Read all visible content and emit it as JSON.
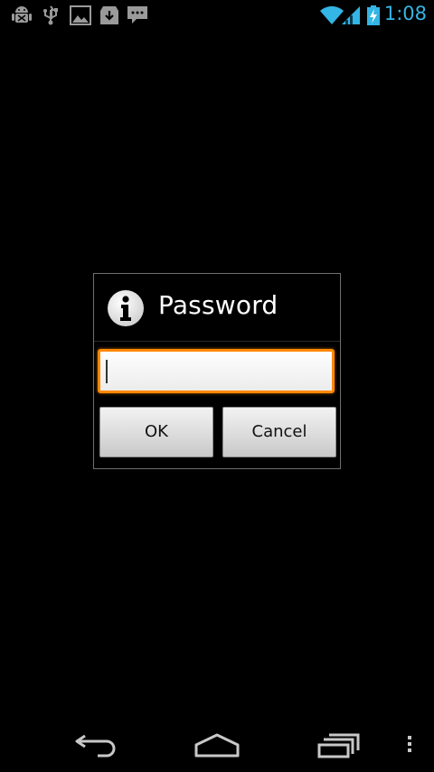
{
  "status_bar": {
    "notification_icons": [
      "android-debug-icon",
      "usb-icon",
      "image-icon",
      "download-icon",
      "message-icon"
    ],
    "time": "1:08",
    "accent_color": "#33b5e5"
  },
  "dialog": {
    "title": "Password",
    "icon": "info-icon",
    "input": {
      "value": "",
      "placeholder": "",
      "focus_color": "#ff8800"
    },
    "ok_label": "OK",
    "cancel_label": "Cancel"
  },
  "nav_bar": {
    "buttons": [
      "back-icon",
      "home-icon",
      "recent-apps-icon",
      "menu-overflow-icon"
    ]
  }
}
